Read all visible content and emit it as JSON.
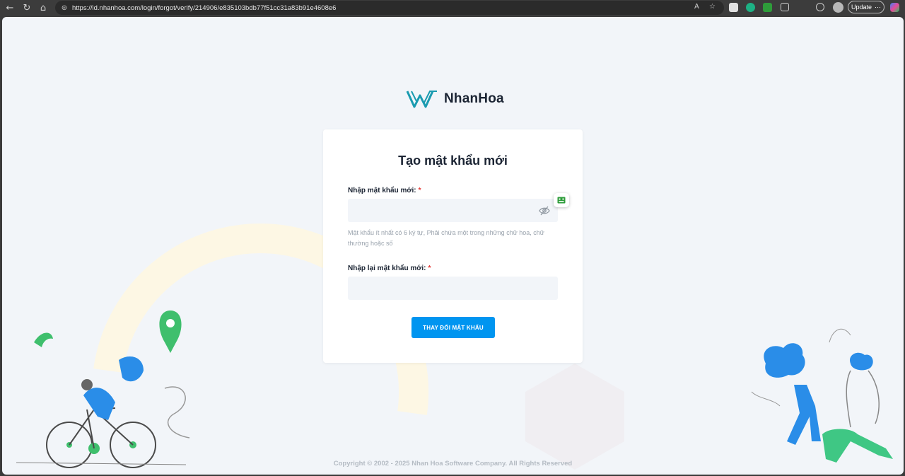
{
  "browser": {
    "url": "https://id.nhanhoa.com/login/forgot/verify/214906/e835103bdb77f51cc31a83b91e4608e6",
    "update_label": "Update",
    "back_icon": "back-arrow-icon",
    "reload_icon": "reload-icon",
    "home_icon": "home-icon"
  },
  "logo": {
    "brand": "NhanHoa"
  },
  "form": {
    "title": "Tạo mật khẩu mới",
    "new_password_label": "Nhập mật khẩu mới:",
    "confirm_password_label": "Nhập lại mật khẩu mới:",
    "required_mark": "*",
    "new_password_value": "",
    "confirm_password_value": "",
    "hint": "Mật khẩu ít nhất có 6 ký tự, Phải chứa một trong những chữ hoa, chữ thường hoặc số",
    "submit_label": "THAY ĐỔI MẬT KHẨU"
  },
  "footer": {
    "copyright": "Copyright © 2002 - 2025 Nhan Hoa Software Company. All Rights Reserved"
  },
  "colors": {
    "accent": "#0095f0",
    "brand_teal": "#1a9bb0",
    "page_bg": "#f2f5f9",
    "required": "#e53935"
  }
}
